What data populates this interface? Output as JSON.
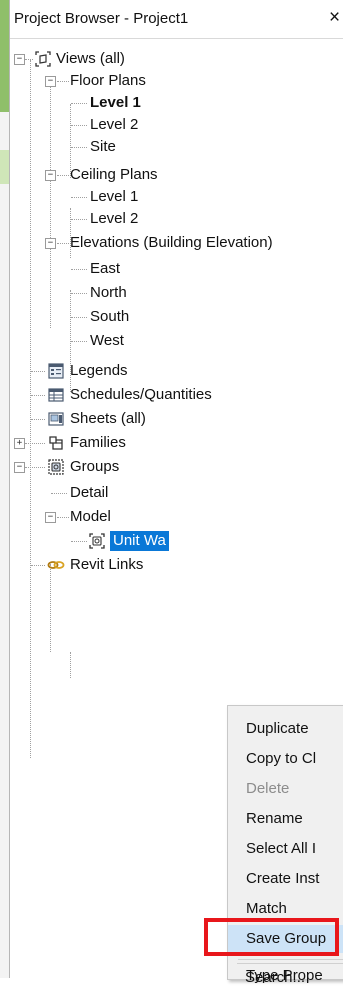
{
  "panel": {
    "title": "Project Browser - Project1",
    "close_glyph": "×"
  },
  "tree": {
    "views_all": "Views (all)",
    "floor_plans": "Floor Plans",
    "fp_level1": "Level 1",
    "fp_level2": "Level 2",
    "fp_site": "Site",
    "ceiling_plans": "Ceiling Plans",
    "cp_level1": "Level 1",
    "cp_level2": "Level 2",
    "elevations": "Elevations (Building Elevation)",
    "el_east": "East",
    "el_north": "North",
    "el_south": "South",
    "el_west": "West",
    "legends": "Legends",
    "schedules": "Schedules/Quantities",
    "sheets": "Sheets (all)",
    "families": "Families",
    "groups": "Groups",
    "detail": "Detail",
    "model": "Model",
    "unit_wa": "Unit Wa",
    "revit_links": "Revit Links",
    "expand_minus": "−",
    "expand_plus": "+"
  },
  "context_menu": {
    "duplicate": "Duplicate",
    "copy_to": "Copy to Cl",
    "delete": "Delete",
    "rename": "Rename",
    "select_all": "Select All I",
    "create_inst": "Create Inst",
    "match": "Match",
    "save_group": "Save Group",
    "type_props": "Type Prope",
    "search": "Search..."
  },
  "colors": {
    "selection": "#0a78d7",
    "menu_hover": "#cde3f7",
    "callout": "#e8161b"
  },
  "icons": {
    "views": "views-icon",
    "legends": "legends-icon",
    "schedules": "schedules-icon",
    "sheets": "sheets-icon",
    "families": "families-icon",
    "groups": "groups-icon",
    "group_item": "group-item-icon",
    "revit_links": "revit-links-icon"
  }
}
